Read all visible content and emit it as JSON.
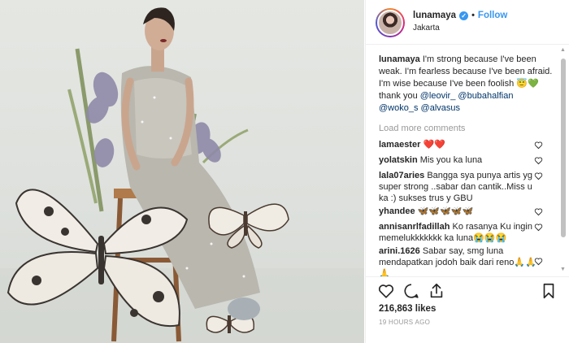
{
  "post": {
    "username": "lunamaya",
    "verified_mark": "✓",
    "separator": "•",
    "follow_label": "Follow",
    "location": "Jakarta"
  },
  "caption": {
    "username": "lunamaya",
    "text": "I'm strong because I've been weak. I'm fearless because I've been afraid. I'm wise because I've been foolish 😇💚 thank you",
    "mentions": [
      "@leovir_",
      "@bubahalfian",
      "@woko_s",
      "@alvasus"
    ]
  },
  "load_more_label": "Load more comments",
  "comments": [
    {
      "user": "lamaester",
      "text": "❤️❤️"
    },
    {
      "user": "yolatskin",
      "text": "Mis you ka luna"
    },
    {
      "user": "lala07aries",
      "text": "Bangga sya punya artis yg super strong ..sabar dan cantik..Miss u ka :) sukses trus y GBU"
    },
    {
      "user": "yhandee",
      "text": "🦋🦋🦋🦋🦋"
    },
    {
      "user": "annisanrlfadillah",
      "text": "Ko rasanya Ku ingin memelukkkkkkk ka luna😭😭😭"
    },
    {
      "user": "arini.1626",
      "text": "Sabar say, smg luna mendapatkan jodoh baik dari reno🙏🙏🙏"
    }
  ],
  "likes": "216,863 likes",
  "timestamp": "19 HOURS AGO",
  "icons": {
    "like": "heart-icon",
    "comment": "comment-icon",
    "share": "share-icon",
    "save": "bookmark-icon",
    "scroll_up": "▲",
    "scroll_down": "▼"
  },
  "colors": {
    "link": "#3897f0",
    "mention": "#003569",
    "muted": "#999999"
  }
}
